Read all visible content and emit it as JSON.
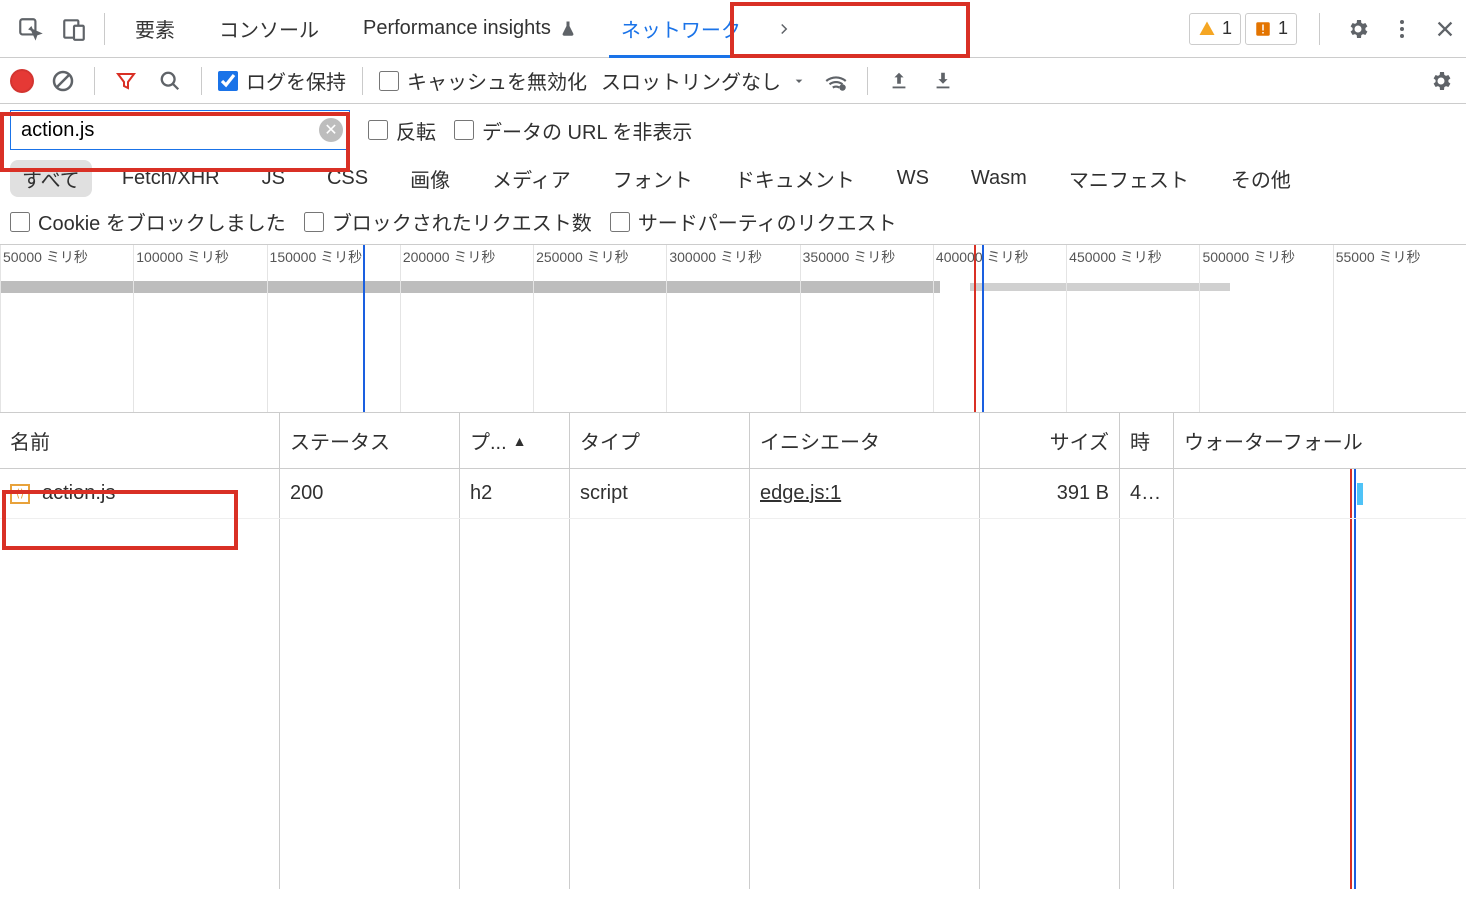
{
  "tabs": {
    "elements": "要素",
    "console": "コンソール",
    "performance": "Performance insights",
    "network": "ネットワーク"
  },
  "badges": {
    "warnings": "1",
    "issues": "1"
  },
  "toolbar": {
    "preserve_log": "ログを保持",
    "disable_cache": "キャッシュを無効化",
    "throttling": "スロットリングなし"
  },
  "filter": {
    "value": "action.js",
    "invert": "反転",
    "hide_data_urls": "データの URL を非表示",
    "types": {
      "all": "すべて",
      "fetchxhr": "Fetch/XHR",
      "js": "JS",
      "css": "CSS",
      "img": "画像",
      "media": "メディア",
      "font": "フォント",
      "doc": "ドキュメント",
      "ws": "WS",
      "wasm": "Wasm",
      "manifest": "マニフェスト",
      "other": "その他"
    },
    "blocked_cookies": "Cookie をブロックしました",
    "blocked_requests": "ブロックされたリクエスト数",
    "third_party": "サードパーティのリクエスト"
  },
  "timeline": {
    "unit": " ミリ秒",
    "ticks": [
      "50000",
      "100000",
      "150000",
      "200000",
      "250000",
      "300000",
      "350000",
      "400000",
      "450000",
      "500000",
      "55000"
    ]
  },
  "columns": {
    "name": "名前",
    "status": "ステータス",
    "protocol": "プ...",
    "type": "タイプ",
    "initiator": "イニシエータ",
    "size": "サイズ",
    "time": "時",
    "waterfall": "ウォーターフォール"
  },
  "rows": [
    {
      "name": "action.js",
      "status": "200",
      "protocol": "h2",
      "type": "script",
      "initiator": "edge.js:1",
      "size": "391 B",
      "time": "4…"
    }
  ]
}
